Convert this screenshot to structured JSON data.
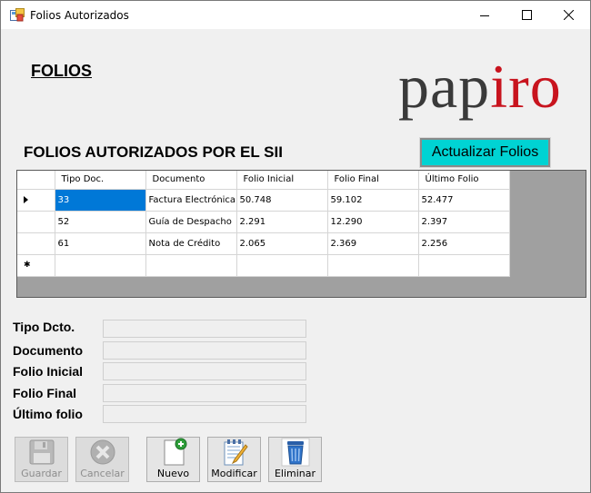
{
  "window": {
    "title": "Folios Autorizados",
    "controls": {
      "minimize": "minimize-icon",
      "maximize": "maximize-icon",
      "close": "close-icon"
    }
  },
  "header": {
    "heading": "FOLIOS",
    "logo_part1": "pap",
    "logo_part2": "iro",
    "logo_colors": {
      "dark": "#3a3a3a",
      "red": "#c8141e"
    }
  },
  "section": {
    "title": "FOLIOS AUTORIZADOS POR EL SII",
    "refresh_label": "Actualizar Folios",
    "refresh_color": "#00d3d3"
  },
  "grid": {
    "columns": [
      "Tipo Doc.",
      "Documento",
      "Folio Inicial",
      "Folio Final",
      "Último Folio"
    ],
    "rows": [
      {
        "marker": "current",
        "cells": [
          "33",
          "Factura Electrónica",
          "50.748",
          "59.102",
          "52.477"
        ]
      },
      {
        "marker": "",
        "cells": [
          "52",
          "Guía de Despacho",
          "2.291",
          "12.290",
          "2.397"
        ]
      },
      {
        "marker": "",
        "cells": [
          "61",
          "Nota de Crédito",
          "2.065",
          "2.369",
          "2.256"
        ]
      },
      {
        "marker": "new",
        "cells": [
          "",
          "",
          "",
          "",
          ""
        ]
      }
    ],
    "selection_color": "#0078d7"
  },
  "form": {
    "labels": [
      "Tipo Dcto.",
      "Documento",
      "Folio Inicial",
      "Folio Final",
      "Último folio"
    ],
    "values": [
      "",
      "",
      "",
      "",
      ""
    ]
  },
  "toolbar": {
    "guardar": "Guardar",
    "cancelar": "Cancelar",
    "nuevo": "Nuevo",
    "modificar": "Modificar",
    "eliminar": "Eliminar"
  }
}
